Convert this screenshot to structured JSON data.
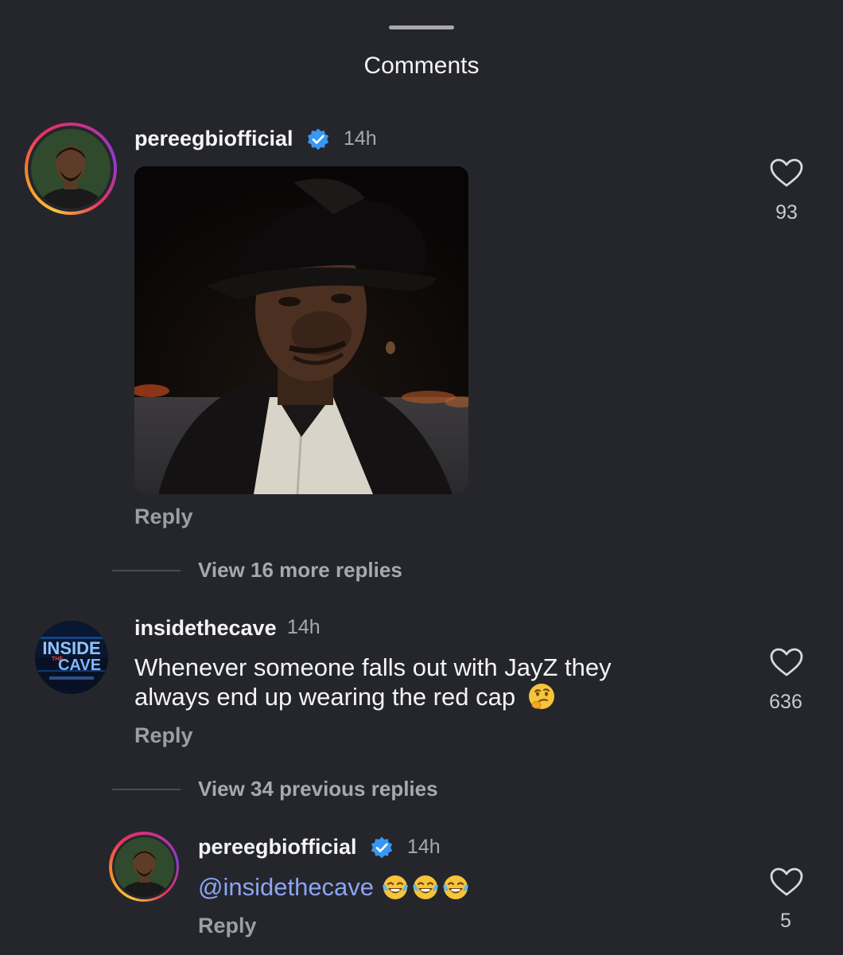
{
  "sheet": {
    "title": "Comments"
  },
  "comments": [
    {
      "username": "pereegbiofficial",
      "verified": true,
      "timestamp": "14h",
      "attachment": "gif-image",
      "reply_label": "Reply",
      "likes": "93",
      "view_replies": "View 16 more replies"
    },
    {
      "username": "insidethecave",
      "verified": false,
      "timestamp": "14h",
      "text_line1": "Whenever someone falls out with JayZ they",
      "text_line2": "always end up wearing the red cap",
      "emoji": "thinking-face",
      "reply_label": "Reply",
      "likes": "636",
      "view_replies": "View 34 previous replies",
      "avatar_logo": {
        "line1": "INSIDE",
        "line2": "THE",
        "line3": "CAVE"
      }
    }
  ],
  "reply": {
    "username": "pereegbiofficial",
    "verified": true,
    "timestamp": "14h",
    "mention": "@insidethecave",
    "emoji": "face-with-tears-of-joy x3",
    "reply_label": "Reply",
    "likes": "5"
  },
  "colors": {
    "background": "#25262b",
    "mention": "#8ba4f5",
    "verified": "#3897f0",
    "muted_text": "#a8a9ae"
  }
}
